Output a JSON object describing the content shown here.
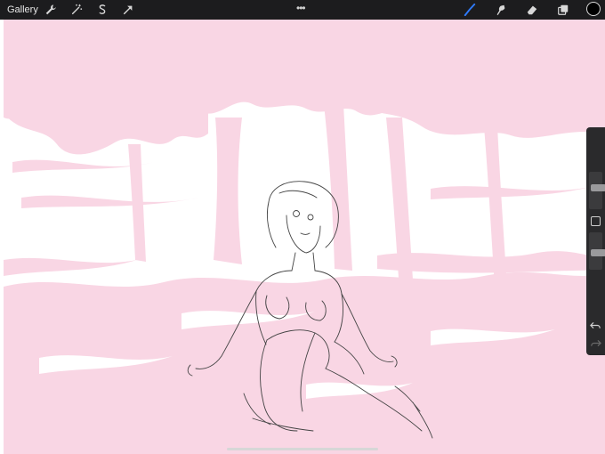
{
  "toolbar": {
    "gallery_label": "Gallery",
    "more_label": "•••",
    "left_tools": [
      "wrench-icon",
      "magic-wand-icon",
      "selection-icon",
      "transform-arrow-icon"
    ],
    "right_tools": [
      "brush-icon",
      "smudge-icon",
      "eraser-icon",
      "layers-icon"
    ],
    "active_tool": "brush-icon",
    "active_color": "#000000",
    "accent": "#2f7bff"
  },
  "sidebar": {
    "brush_size": 0.6,
    "opacity": 0.45,
    "undo_icon": "undo-icon",
    "redo_icon": "redo-icon"
  },
  "canvas": {
    "background": "#ffffff",
    "background_painting_color": "#f9d6e4",
    "sketch_color": "#444444"
  }
}
